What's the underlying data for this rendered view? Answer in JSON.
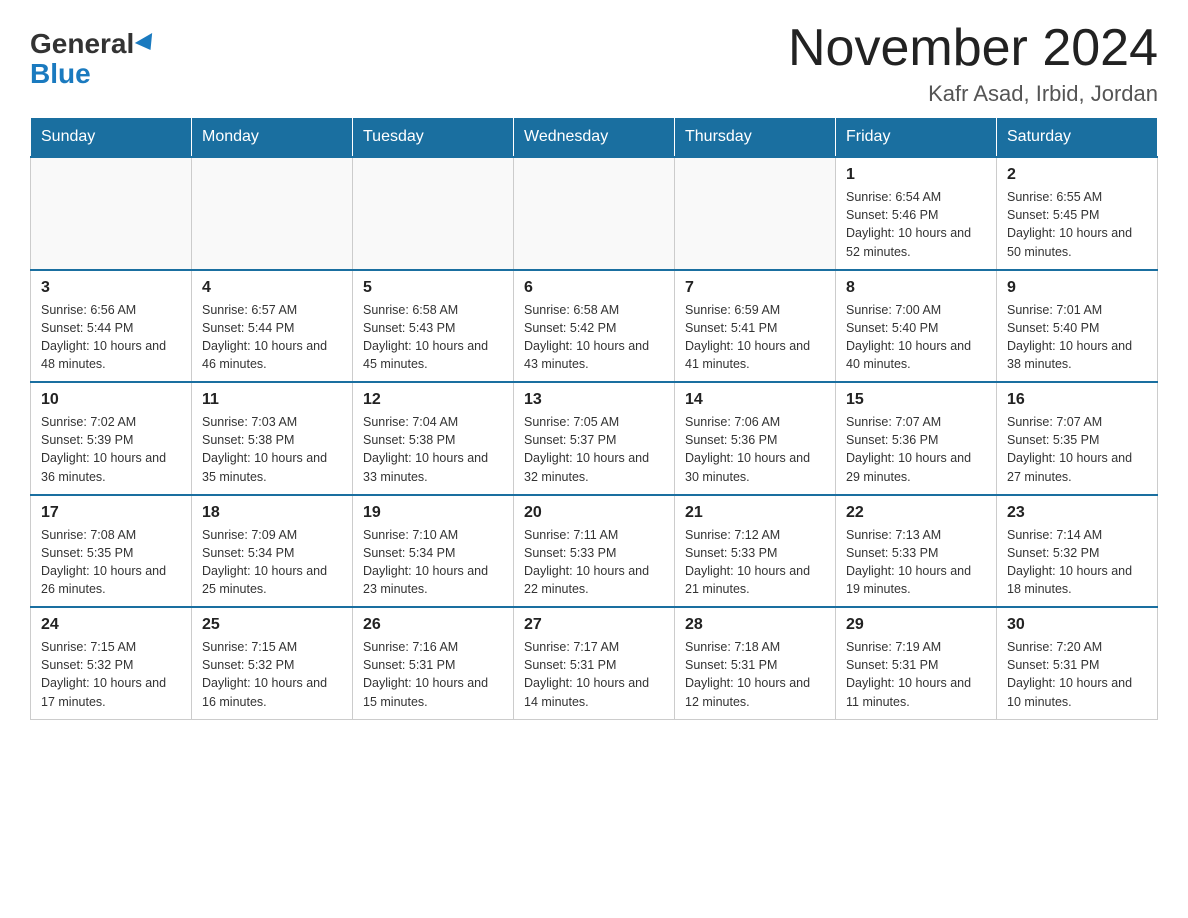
{
  "header": {
    "logo": {
      "general": "General",
      "blue": "Blue"
    },
    "title": "November 2024",
    "location": "Kafr Asad, Irbid, Jordan"
  },
  "days_of_week": [
    "Sunday",
    "Monday",
    "Tuesday",
    "Wednesday",
    "Thursday",
    "Friday",
    "Saturday"
  ],
  "weeks": [
    [
      {
        "day": "",
        "info": ""
      },
      {
        "day": "",
        "info": ""
      },
      {
        "day": "",
        "info": ""
      },
      {
        "day": "",
        "info": ""
      },
      {
        "day": "",
        "info": ""
      },
      {
        "day": "1",
        "info": "Sunrise: 6:54 AM\nSunset: 5:46 PM\nDaylight: 10 hours and 52 minutes."
      },
      {
        "day": "2",
        "info": "Sunrise: 6:55 AM\nSunset: 5:45 PM\nDaylight: 10 hours and 50 minutes."
      }
    ],
    [
      {
        "day": "3",
        "info": "Sunrise: 6:56 AM\nSunset: 5:44 PM\nDaylight: 10 hours and 48 minutes."
      },
      {
        "day": "4",
        "info": "Sunrise: 6:57 AM\nSunset: 5:44 PM\nDaylight: 10 hours and 46 minutes."
      },
      {
        "day": "5",
        "info": "Sunrise: 6:58 AM\nSunset: 5:43 PM\nDaylight: 10 hours and 45 minutes."
      },
      {
        "day": "6",
        "info": "Sunrise: 6:58 AM\nSunset: 5:42 PM\nDaylight: 10 hours and 43 minutes."
      },
      {
        "day": "7",
        "info": "Sunrise: 6:59 AM\nSunset: 5:41 PM\nDaylight: 10 hours and 41 minutes."
      },
      {
        "day": "8",
        "info": "Sunrise: 7:00 AM\nSunset: 5:40 PM\nDaylight: 10 hours and 40 minutes."
      },
      {
        "day": "9",
        "info": "Sunrise: 7:01 AM\nSunset: 5:40 PM\nDaylight: 10 hours and 38 minutes."
      }
    ],
    [
      {
        "day": "10",
        "info": "Sunrise: 7:02 AM\nSunset: 5:39 PM\nDaylight: 10 hours and 36 minutes."
      },
      {
        "day": "11",
        "info": "Sunrise: 7:03 AM\nSunset: 5:38 PM\nDaylight: 10 hours and 35 minutes."
      },
      {
        "day": "12",
        "info": "Sunrise: 7:04 AM\nSunset: 5:38 PM\nDaylight: 10 hours and 33 minutes."
      },
      {
        "day": "13",
        "info": "Sunrise: 7:05 AM\nSunset: 5:37 PM\nDaylight: 10 hours and 32 minutes."
      },
      {
        "day": "14",
        "info": "Sunrise: 7:06 AM\nSunset: 5:36 PM\nDaylight: 10 hours and 30 minutes."
      },
      {
        "day": "15",
        "info": "Sunrise: 7:07 AM\nSunset: 5:36 PM\nDaylight: 10 hours and 29 minutes."
      },
      {
        "day": "16",
        "info": "Sunrise: 7:07 AM\nSunset: 5:35 PM\nDaylight: 10 hours and 27 minutes."
      }
    ],
    [
      {
        "day": "17",
        "info": "Sunrise: 7:08 AM\nSunset: 5:35 PM\nDaylight: 10 hours and 26 minutes."
      },
      {
        "day": "18",
        "info": "Sunrise: 7:09 AM\nSunset: 5:34 PM\nDaylight: 10 hours and 25 minutes."
      },
      {
        "day": "19",
        "info": "Sunrise: 7:10 AM\nSunset: 5:34 PM\nDaylight: 10 hours and 23 minutes."
      },
      {
        "day": "20",
        "info": "Sunrise: 7:11 AM\nSunset: 5:33 PM\nDaylight: 10 hours and 22 minutes."
      },
      {
        "day": "21",
        "info": "Sunrise: 7:12 AM\nSunset: 5:33 PM\nDaylight: 10 hours and 21 minutes."
      },
      {
        "day": "22",
        "info": "Sunrise: 7:13 AM\nSunset: 5:33 PM\nDaylight: 10 hours and 19 minutes."
      },
      {
        "day": "23",
        "info": "Sunrise: 7:14 AM\nSunset: 5:32 PM\nDaylight: 10 hours and 18 minutes."
      }
    ],
    [
      {
        "day": "24",
        "info": "Sunrise: 7:15 AM\nSunset: 5:32 PM\nDaylight: 10 hours and 17 minutes."
      },
      {
        "day": "25",
        "info": "Sunrise: 7:15 AM\nSunset: 5:32 PM\nDaylight: 10 hours and 16 minutes."
      },
      {
        "day": "26",
        "info": "Sunrise: 7:16 AM\nSunset: 5:31 PM\nDaylight: 10 hours and 15 minutes."
      },
      {
        "day": "27",
        "info": "Sunrise: 7:17 AM\nSunset: 5:31 PM\nDaylight: 10 hours and 14 minutes."
      },
      {
        "day": "28",
        "info": "Sunrise: 7:18 AM\nSunset: 5:31 PM\nDaylight: 10 hours and 12 minutes."
      },
      {
        "day": "29",
        "info": "Sunrise: 7:19 AM\nSunset: 5:31 PM\nDaylight: 10 hours and 11 minutes."
      },
      {
        "day": "30",
        "info": "Sunrise: 7:20 AM\nSunset: 5:31 PM\nDaylight: 10 hours and 10 minutes."
      }
    ]
  ]
}
